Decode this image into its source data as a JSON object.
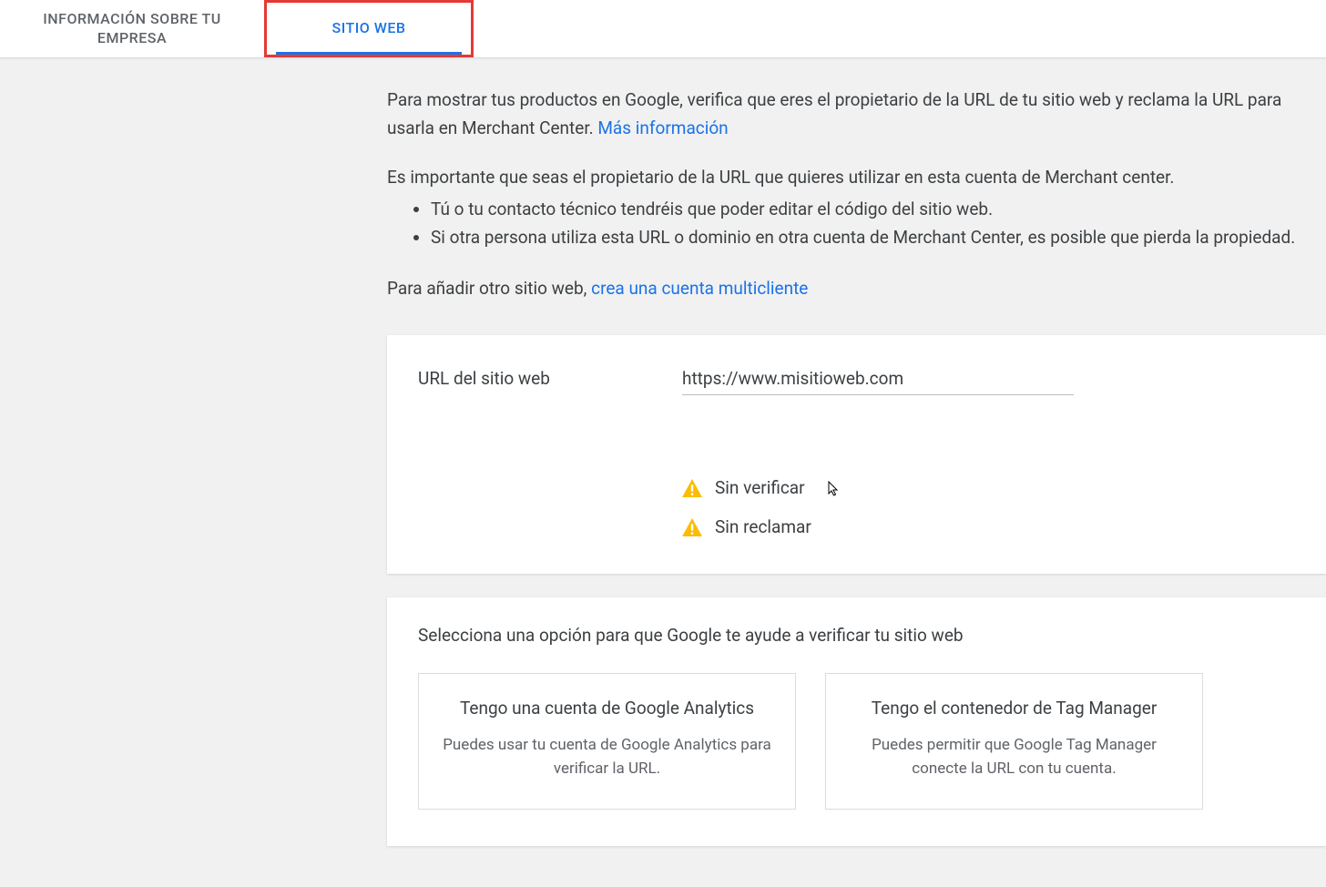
{
  "tabs": {
    "business": "INFORMACIÓN SOBRE TU EMPRESA",
    "website": "SITIO WEB"
  },
  "intro": {
    "text1": "Para mostrar tus productos en Google, verifica que eres el propietario de la URL de tu sitio web y reclama la URL para usarla en Merchant Center. ",
    "link1": "Más información",
    "text2": "Es importante que seas el propietario de la URL que quieres utilizar en esta cuenta de Merchant center.",
    "bullet1": "Tú o tu contacto técnico tendréis que poder editar el código del sitio web.",
    "bullet2": "Si otra persona utiliza esta URL o dominio en otra cuenta de Merchant Center, es posible que pierda la propiedad.",
    "add_site_text": "Para añadir otro sitio web, ",
    "add_site_link": "crea una cuenta multicliente"
  },
  "url_section": {
    "label": "URL del sitio web",
    "value": "https://www.misitioweb.com",
    "status_unverified": "Sin verificar",
    "status_unclaimed": "Sin reclamar"
  },
  "verify": {
    "title": "Selecciona una opción para que Google te ayude a verificar tu sitio web",
    "option1_title": "Tengo una cuenta de Google Analytics",
    "option1_desc": "Puedes usar tu cuenta de Google Analytics para verificar la URL.",
    "option2_title": "Tengo el contenedor de Tag Manager",
    "option2_desc": "Puedes permitir que Google Tag Manager conecte la URL con tu cuenta."
  }
}
